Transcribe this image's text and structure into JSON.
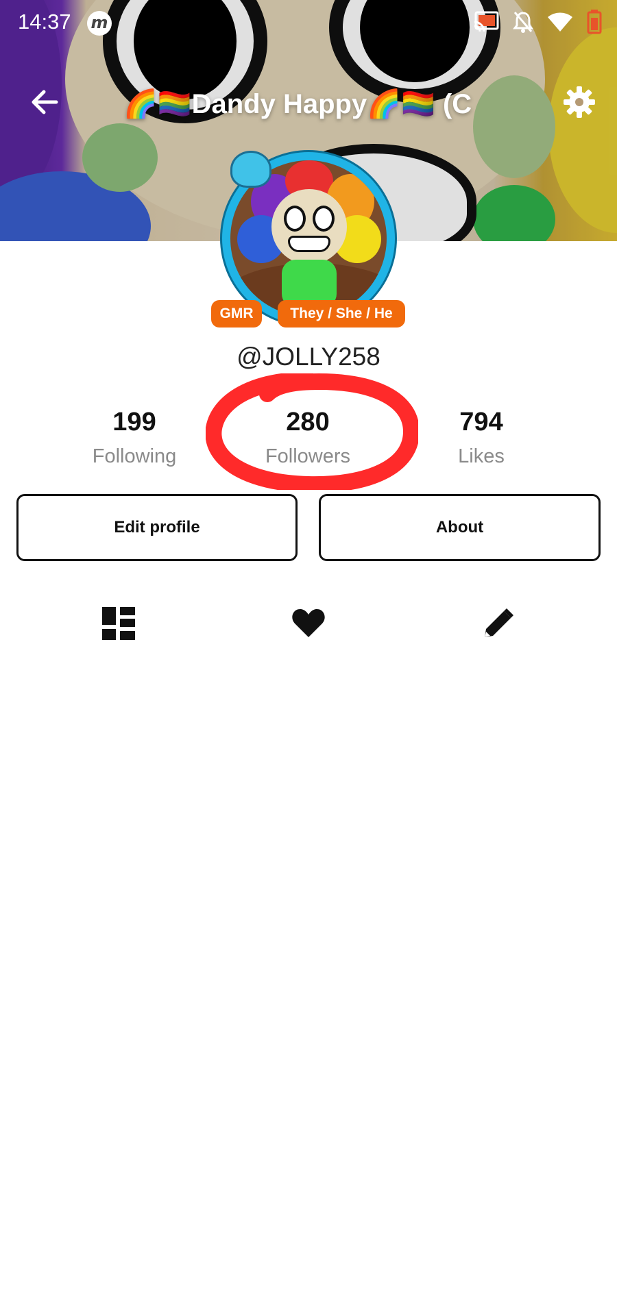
{
  "status_bar": {
    "time": "14:37",
    "app_badge": "m"
  },
  "header": {
    "title": "🌈🏳️‍🌈Dandy Happy🌈🏳️‍🌈 (C"
  },
  "profile": {
    "badges": [
      "GMR",
      "They / She / He"
    ],
    "username": "@JOLLY258"
  },
  "stats": [
    {
      "value": "199",
      "label": "Following"
    },
    {
      "value": "280",
      "label": "Followers"
    },
    {
      "value": "794",
      "label": "Likes"
    }
  ],
  "buttons": {
    "edit": "Edit profile",
    "about": "About"
  },
  "tabs": [
    {
      "icon": "grid-layout-icon"
    },
    {
      "icon": "heart-icon"
    },
    {
      "icon": "pencil-icon"
    }
  ],
  "colors": {
    "accent": "#f16a0c",
    "annotation": "#ff2a2a",
    "avatar_ring": "#20b4e6"
  }
}
